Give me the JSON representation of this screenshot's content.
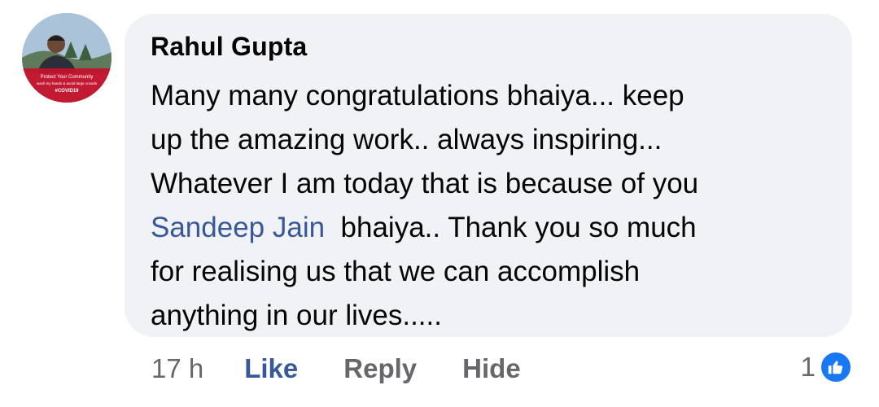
{
  "comment": {
    "author": "Rahul Gupta",
    "text_lines": {
      "line1": "Many many congratulations bhaiya... keep",
      "line2": "up the amazing work.. always inspiring...",
      "line3": "Whatever I am today that is because of you",
      "line4_mention": "Sandeep Jain",
      "line4_rest": "  bhaiya.. Thank you so much",
      "line5": "for realising us that we can accomplish",
      "line6": "anything in our lives....."
    },
    "avatar_overlay_text": {
      "line1": "Protect Your Community",
      "line2": "wash my hands & avoid large crowds",
      "line3": "#COVID19"
    }
  },
  "actions": {
    "timestamp": "17 h",
    "like_label": "Like",
    "reply_label": "Reply",
    "hide_label": "Hide"
  },
  "reactions": {
    "count": "1",
    "icon": "thumbs-up-icon",
    "color": "#1877f2"
  },
  "colors": {
    "bubble_bg": "#f0f2f5",
    "mention": "#385898",
    "like_active": "#385898",
    "muted": "#65676b"
  }
}
